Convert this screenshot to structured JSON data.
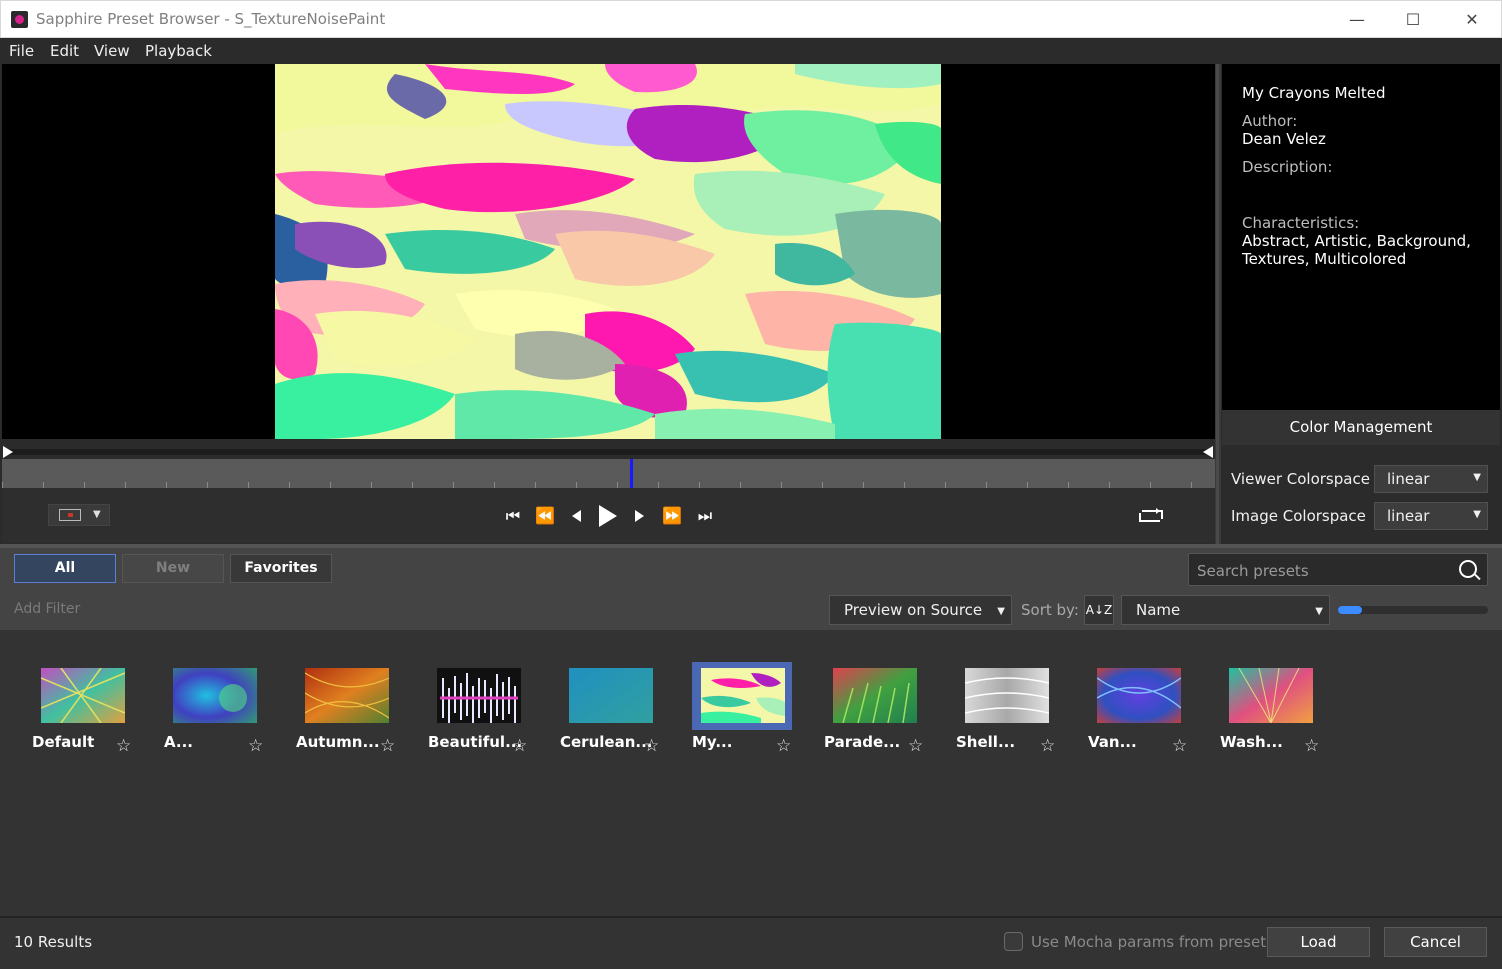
{
  "window": {
    "title": "Sapphire Preset Browser - S_TextureNoisePaint",
    "minimize_glyph": "—",
    "maximize_glyph": "☐",
    "close_glyph": "✕"
  },
  "menu": [
    "File",
    "Edit",
    "View",
    "Playback"
  ],
  "transport": {
    "first": "⏮",
    "rewind": "⏪",
    "step_back": "◀",
    "play": "▶",
    "step_fwd": "▶",
    "ffwd": "⏩",
    "last": "⏭",
    "loop": "loop-icon",
    "view_mode_caret": "▼",
    "playhead_position": 0.518
  },
  "info": {
    "name": "My Crayons Melted",
    "author_label": "Author:",
    "author": "Dean Velez",
    "description_label": "Description:",
    "description": "",
    "characteristics_label": "Characteristics:",
    "characteristics": "Abstract, Artistic, Background, Textures, Multicolored"
  },
  "color_management": {
    "header": "Color Management",
    "viewer_label": "Viewer Colorspace",
    "viewer_value": "linear",
    "image_label": "Image Colorspace",
    "image_value": "linear"
  },
  "tabs": {
    "all": "All",
    "new": "New",
    "favorites": "Favorites"
  },
  "search": {
    "placeholder": "Search presets"
  },
  "filter": {
    "add_filter": "Add Filter"
  },
  "preview_mode": "Preview on Source",
  "sort": {
    "label": "Sort by:",
    "value": "Name",
    "direction_icon": "A↓Z"
  },
  "thumb_size": 0.16,
  "presets": [
    {
      "label": "Default",
      "star": "☆"
    },
    {
      "label": "A...",
      "star": "☆"
    },
    {
      "label": "Autumn...",
      "star": "☆"
    },
    {
      "label": "Beautiful...",
      "star": "☆"
    },
    {
      "label": "Cerulean...",
      "star": "☆"
    },
    {
      "label": "My...",
      "star": "☆",
      "selected": true
    },
    {
      "label": "Parade...",
      "star": "☆"
    },
    {
      "label": "Shell...",
      "star": "☆"
    },
    {
      "label": "Van...",
      "star": "☆"
    },
    {
      "label": "Wash...",
      "star": "☆"
    }
  ],
  "status": {
    "results": "10 Results",
    "mocha_label": "Use Mocha params from preset",
    "load": "Load",
    "cancel": "Cancel"
  },
  "colors": {
    "accent": "#3d8cff",
    "selected_tab_border": "#5c7ed6",
    "selection": "#4a68b4",
    "playhead": "#1a1aff"
  }
}
